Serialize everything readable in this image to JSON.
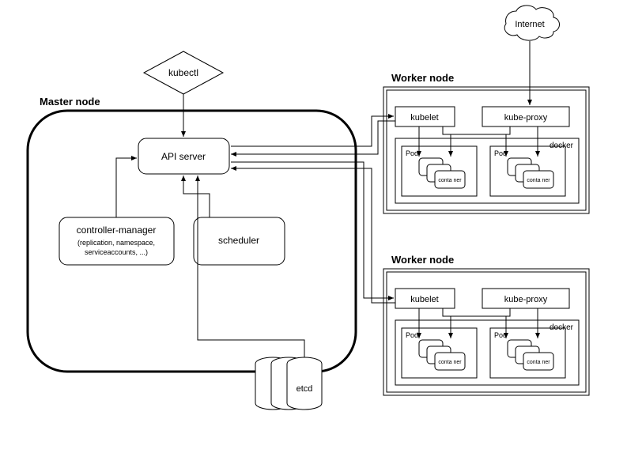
{
  "internet": "Internet",
  "kubectl": "kubectl",
  "master": {
    "title": "Master node",
    "api_server": "API server",
    "controller_manager": "controller-manager",
    "controller_manager_sub": "(replication, namespace,\nserviceaccounts, ...)",
    "scheduler": "scheduler",
    "etcd": "etcd"
  },
  "worker": {
    "title": "Worker node",
    "kubelet": "kubelet",
    "kube_proxy": "kube-proxy",
    "docker": "docker",
    "pod": "Pod",
    "container": "conta ner"
  }
}
